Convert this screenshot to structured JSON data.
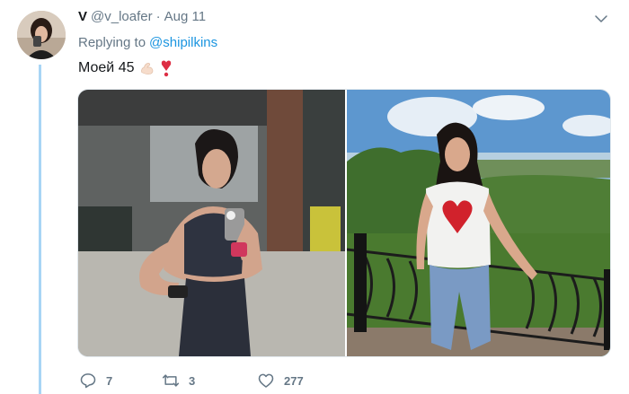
{
  "tweet": {
    "display_name": "V",
    "handle": "@v_loafer",
    "separator": "·",
    "date": "Aug 11",
    "replying_prefix": "Replying to",
    "replying_to": "@shipilkins",
    "text": "Моей 45"
  },
  "icons": {
    "avatar": "avatar-photo",
    "menu": "chevron-down-icon",
    "reply": "reply-icon",
    "retweet": "retweet-icon",
    "like": "heart-icon",
    "emoji_1": "flexed-biceps-emoji",
    "emoji_2": "heavy-exclamation-heart-emoji"
  },
  "media": {
    "photos": [
      {
        "name": "gym-mirror-selfie"
      },
      {
        "name": "outdoor-railing-photo"
      }
    ]
  },
  "actions": {
    "reply_count": "7",
    "retweet_count": "3",
    "like_count": "277"
  },
  "colors": {
    "link": "#1b95e0",
    "muted": "#657786",
    "thread_line": "#a8d5f5",
    "text": "#14171a"
  }
}
